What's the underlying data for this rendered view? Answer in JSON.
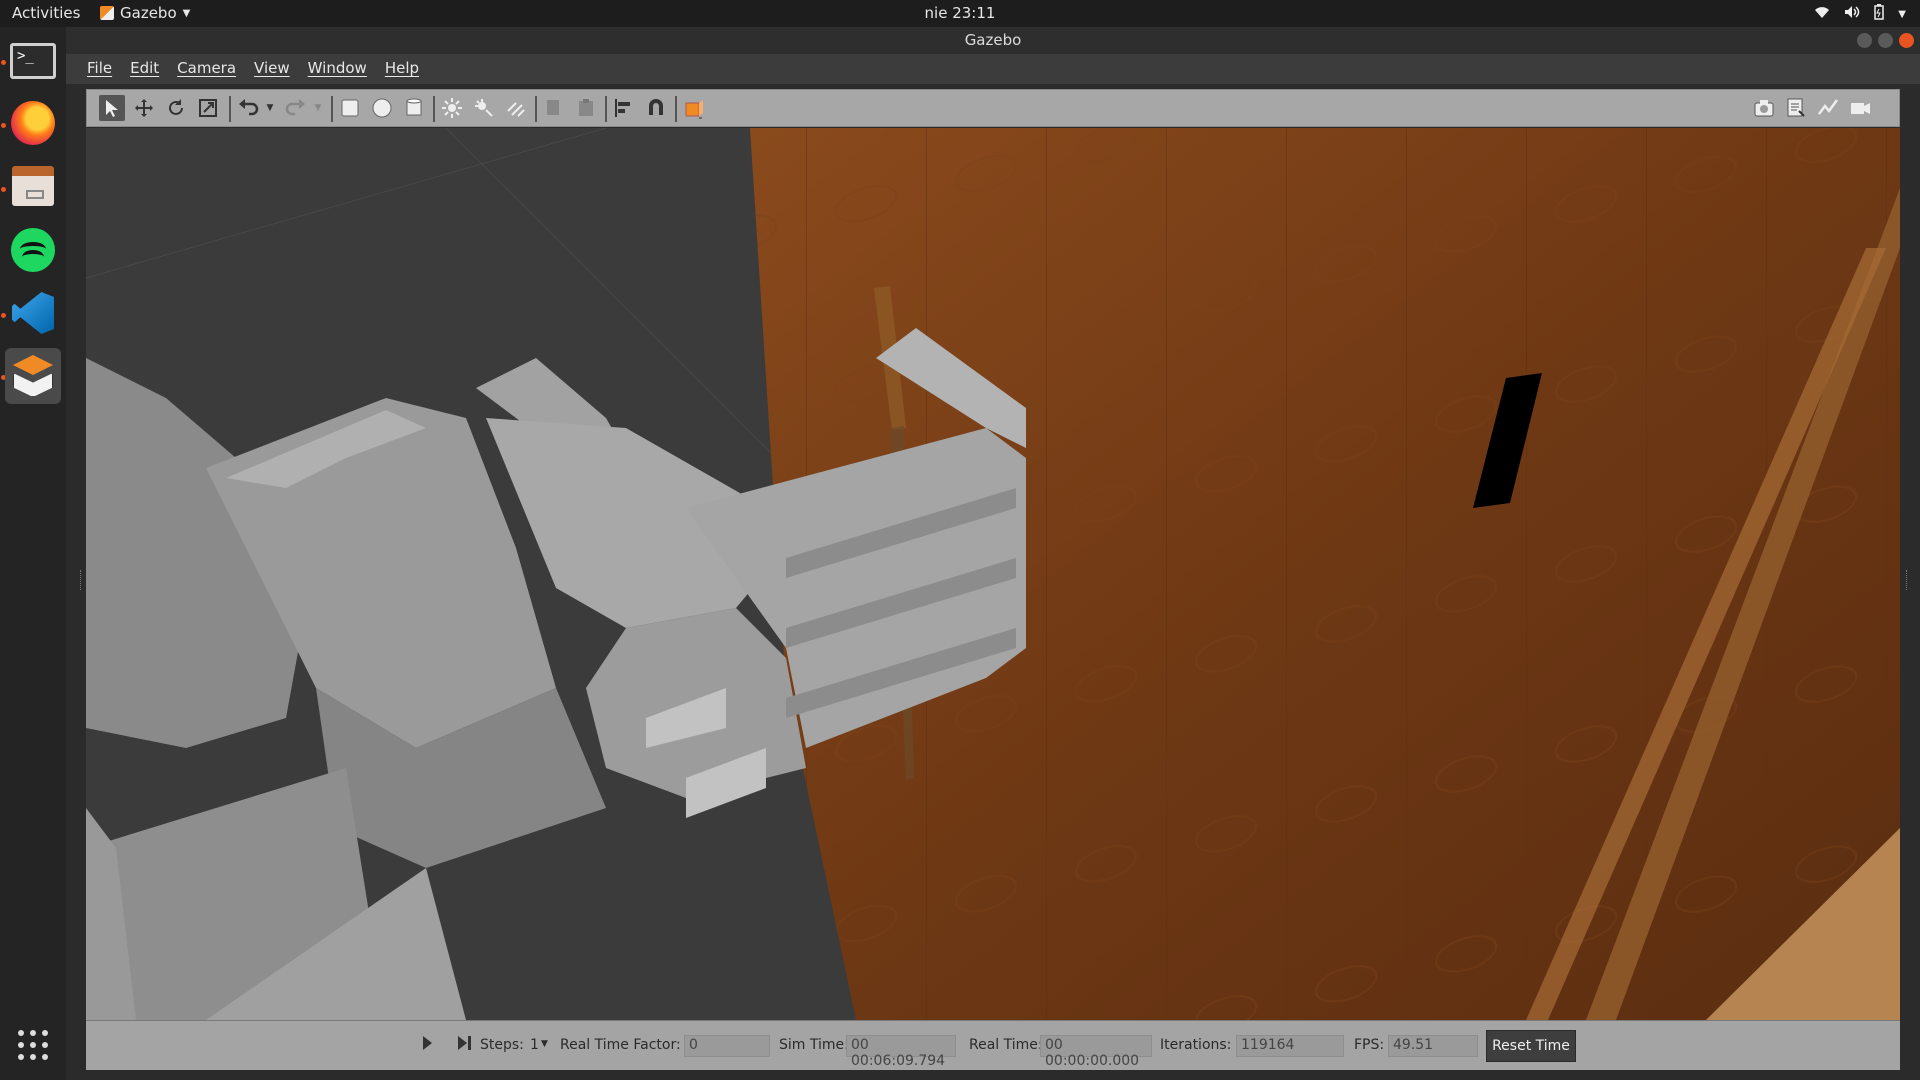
{
  "topbar": {
    "activities": "Activities",
    "app_name": "Gazebo",
    "clock": "nie 23:11"
  },
  "window": {
    "title": "Gazebo"
  },
  "menu": {
    "file": "File",
    "edit": "Edit",
    "camera": "Camera",
    "view": "View",
    "window": "Window",
    "help": "Help"
  },
  "dock": {
    "items": [
      "terminal-icon",
      "firefox-icon",
      "files-icon",
      "spotify-icon",
      "vscode-icon",
      "gazebo-icon"
    ]
  },
  "status": {
    "steps_label": "Steps:",
    "steps_value": "1",
    "rtf_label": "Real Time Factor:",
    "rtf_value": "0",
    "sim_time_label": "Sim Time:",
    "sim_time_value": "00 00:06:09.794",
    "real_time_label": "Real Time:",
    "real_time_value": "00 00:00:00.000",
    "iterations_label": "Iterations:",
    "iterations_value": "119164",
    "fps_label": "FPS:",
    "fps_value": "49.51",
    "reset_label": "Reset Time"
  },
  "colors": {
    "accent": "#e95420",
    "toolbar_bg": "#a7a7a7",
    "wood": "#7a3f17"
  }
}
